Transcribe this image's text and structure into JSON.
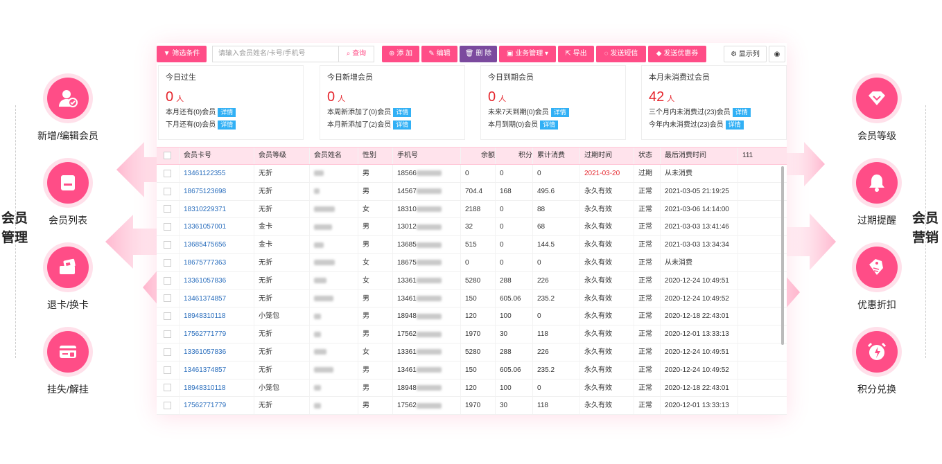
{
  "left_group": {
    "line1": "会员",
    "line2": "管理"
  },
  "right_group": {
    "line1": "会员",
    "line2": "营销"
  },
  "left_features": [
    {
      "label": "新增/编辑会员",
      "icon": "user-check-icon"
    },
    {
      "label": "会员列表",
      "icon": "list-icon"
    },
    {
      "label": "退卡/换卡",
      "icon": "card-swap-icon"
    },
    {
      "label": "挂失/解挂",
      "icon": "card-lock-icon"
    }
  ],
  "right_features": [
    {
      "label": "会员等级",
      "icon": "diamond-icon"
    },
    {
      "label": "过期提醒",
      "icon": "bell-icon"
    },
    {
      "label": "优惠折扣",
      "icon": "tag-icon"
    },
    {
      "label": "积分兑换",
      "icon": "alarm-icon"
    }
  ],
  "toolbar": {
    "filter": "筛选条件",
    "search_placeholder": "请输入会员姓名/卡号/手机号",
    "search": "查询",
    "add": "添 加",
    "edit": "编辑",
    "delete": "删 除",
    "business": "业务管理",
    "export": "导出",
    "sms": "发送短信",
    "coupon": "发送优惠券",
    "columns": "显示列"
  },
  "stats": [
    {
      "title": "今日过生",
      "num": "0",
      "unit": "人",
      "lines": [
        "本月还有(0)会员",
        "下月还有(0)会员"
      ],
      "tag": "详情"
    },
    {
      "title": "今日新增会员",
      "num": "0",
      "unit": "人",
      "lines": [
        "本周新添加了(0)会员",
        "本月新添加了(2)会员"
      ],
      "tag": "详情"
    },
    {
      "title": "今日到期会员",
      "num": "0",
      "unit": "人",
      "lines": [
        "未来7天到期(0)会员",
        "本月到期(0)会员"
      ],
      "tag": "详情"
    },
    {
      "title": "本月未消费过会员",
      "num": "42",
      "unit": "人",
      "lines": [
        "三个月内未消费过(23)会员",
        "今年内未消费过(23)会员"
      ],
      "tag": "详情"
    }
  ],
  "table": {
    "headers": [
      "会员卡号",
      "会员等级",
      "会员姓名",
      "性别",
      "手机号",
      "余额",
      "积分",
      "累计消费",
      "过期时间",
      "状态",
      "最后消费时间",
      "111"
    ],
    "rows": [
      {
        "card": "13461122355",
        "level": "无折",
        "gender": "男",
        "phone": "18566",
        "balance": "0",
        "points": "0",
        "total": "0",
        "expire": "2021-03-20",
        "status": "过期",
        "last": "从未消费",
        "expired": true
      },
      {
        "card": "18675123698",
        "level": "无折",
        "gender": "男",
        "phone": "14567",
        "balance": "704.4",
        "points": "168",
        "total": "495.6",
        "expire": "永久有效",
        "status": "正常",
        "last": "2021-03-05 21:19:25"
      },
      {
        "card": "18310229371",
        "level": "无折",
        "gender": "女",
        "phone": "18310",
        "balance": "2188",
        "points": "0",
        "total": "88",
        "expire": "永久有效",
        "status": "正常",
        "last": "2021-03-06 14:14:00"
      },
      {
        "card": "13361057001",
        "level": "金卡",
        "gender": "男",
        "phone": "13012",
        "balance": "32",
        "points": "0",
        "total": "68",
        "expire": "永久有效",
        "status": "正常",
        "last": "2021-03-03 13:41:46"
      },
      {
        "card": "13685475656",
        "level": "金卡",
        "gender": "男",
        "phone": "13685",
        "balance": "515",
        "points": "0",
        "total": "144.5",
        "expire": "永久有效",
        "status": "正常",
        "last": "2021-03-03 13:34:34"
      },
      {
        "card": "18675777363",
        "level": "无折",
        "gender": "女",
        "phone": "18675",
        "balance": "0",
        "points": "0",
        "total": "0",
        "expire": "永久有效",
        "status": "正常",
        "last": "从未消费"
      },
      {
        "card": "13361057836",
        "level": "无折",
        "gender": "女",
        "phone": "13361",
        "balance": "5280",
        "points": "288",
        "total": "226",
        "expire": "永久有效",
        "status": "正常",
        "last": "2020-12-24 10:49:51"
      },
      {
        "card": "13461374857",
        "level": "无折",
        "gender": "男",
        "phone": "13461",
        "balance": "150",
        "points": "605.06",
        "total": "235.2",
        "expire": "永久有效",
        "status": "正常",
        "last": "2020-12-24 10:49:52"
      },
      {
        "card": "18948310118",
        "level": "小笼包",
        "gender": "男",
        "phone": "18948",
        "balance": "120",
        "points": "100",
        "total": "0",
        "expire": "永久有效",
        "status": "正常",
        "last": "2020-12-18 22:43:01"
      },
      {
        "card": "17562771779",
        "level": "无折",
        "gender": "男",
        "phone": "17562",
        "balance": "1970",
        "points": "30",
        "total": "118",
        "expire": "永久有效",
        "status": "正常",
        "last": "2020-12-01 13:33:13"
      },
      {
        "card": "13361057836",
        "level": "无折",
        "gender": "女",
        "phone": "13361",
        "balance": "5280",
        "points": "288",
        "total": "226",
        "expire": "永久有效",
        "status": "正常",
        "last": "2020-12-24 10:49:51"
      },
      {
        "card": "13461374857",
        "level": "无折",
        "gender": "男",
        "phone": "13461",
        "balance": "150",
        "points": "605.06",
        "total": "235.2",
        "expire": "永久有效",
        "status": "正常",
        "last": "2020-12-24 10:49:52"
      },
      {
        "card": "18948310118",
        "level": "小笼包",
        "gender": "男",
        "phone": "18948",
        "balance": "120",
        "points": "100",
        "total": "0",
        "expire": "永久有效",
        "status": "正常",
        "last": "2020-12-18 22:43:01"
      },
      {
        "card": "17562771779",
        "level": "无折",
        "gender": "男",
        "phone": "17562",
        "balance": "1970",
        "points": "30",
        "total": "118",
        "expire": "永久有效",
        "status": "正常",
        "last": "2020-12-01 13:33:13"
      }
    ]
  },
  "colors": {
    "accent": "#ff4d87",
    "purple": "#7b4a9e",
    "red": "#e5262d",
    "tag": "#31b0f5"
  }
}
